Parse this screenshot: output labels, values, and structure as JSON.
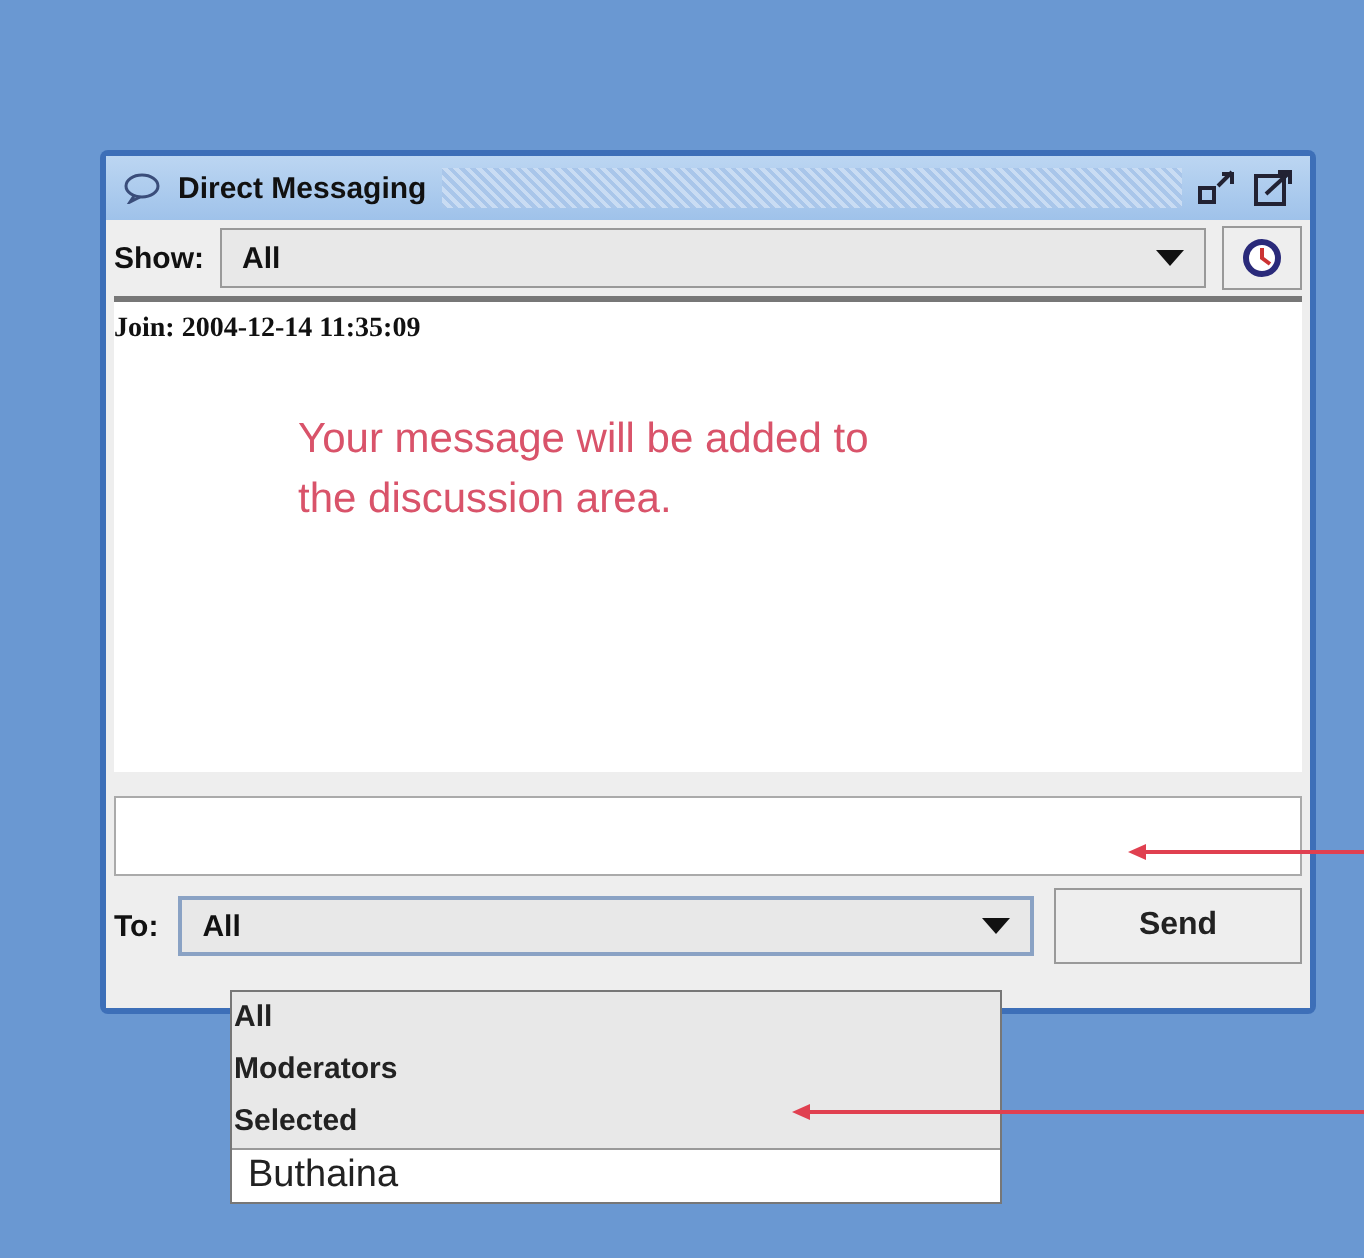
{
  "window": {
    "title": "Direct Messaging"
  },
  "show": {
    "label": "Show:",
    "value": "All"
  },
  "messages": [
    {
      "kind": "join",
      "text": "Join: 2004-12-14 11:35:09"
    }
  ],
  "note": "Your message will be added to the discussion area.",
  "compose": {
    "to_label": "To:",
    "to_value": "All",
    "send": "Send"
  },
  "recipients": [
    {
      "label": "All",
      "kind": "group"
    },
    {
      "label": "Moderators",
      "kind": "group"
    },
    {
      "label": "Selected",
      "kind": "group"
    },
    {
      "label": "Buthaina",
      "kind": "user"
    }
  ]
}
